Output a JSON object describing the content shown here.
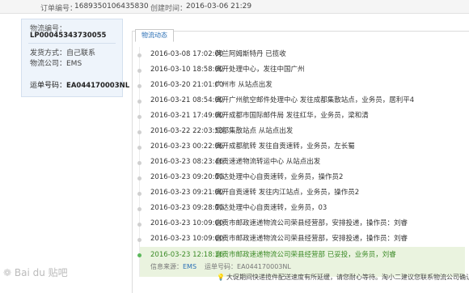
{
  "header": {
    "order_label": "订单编号：",
    "order_number": "1689350106435830",
    "created_label": "创建时间：",
    "created_time": "2016-03-06 21:29"
  },
  "sidebar": {
    "waybill_label": "物流编号：",
    "waybill_number": "LP00045343730055",
    "ship_method": "发货方式：自己联系",
    "carrier": "物流公司：EMS",
    "tracking_label": "运单号码：",
    "tracking_number": "EA044170003NL"
  },
  "tab": {
    "label": "物流动态"
  },
  "events": [
    {
      "time": "2016-03-08 17:02:00",
      "desc": "荷兰阿姆斯特丹 已揽收"
    },
    {
      "time": "2016-03-10 18:58:00",
      "desc": "离开处理中心，发往中国广州"
    },
    {
      "time": "2016-03-20 21:01:00",
      "desc": "广州市 从站点出发"
    },
    {
      "time": "2016-03-21 08:54:00",
      "desc": "离开广州航空邮件处理中心 发往成都集散站点，业务员，居利平4"
    },
    {
      "time": "2016-03-21 17:49:00",
      "desc": "离开成都市国际邮件局 发往红华，业务员，梁和清"
    },
    {
      "time": "2016-03-22 22:03:53",
      "desc": "成都集散站点 从站点出发"
    },
    {
      "time": "2016-03-23 00:22:06",
      "desc": "离开成都航转 发往自贡速转，业务员，左长蜀"
    },
    {
      "time": "2016-03-23 08:23:46",
      "desc": "自贡速递物流转运中心 从站点出发"
    },
    {
      "time": "2016-03-23 09:20:00",
      "desc": "到达处理中心自贡速转，业务员，操作员2"
    },
    {
      "time": "2016-03-23 09:21:00",
      "desc": "离开自贡速转 发往内江站点，业务员，操作员2"
    },
    {
      "time": "2016-03-23 09:28:00",
      "desc": "到达处理中心自贡速转，业务员，03"
    },
    {
      "time": "2016-03-23 10:09:00",
      "desc": "自贡市邮政速递物流公司荣县经营部，安排投递，操作员：刘睿"
    },
    {
      "time": "2016-03-23 10:09:00",
      "desc": "自贡市邮政速递物流公司荣县经营部，安排投递，操作员：刘睿"
    }
  ],
  "latest": {
    "time": "2016-03-23 12:18:36",
    "desc": "自贡市邮政速递物流公司荣县经营部 已妥投，业务员，刘睿",
    "source_label": "信息来源：",
    "source_link": "EMS",
    "tracking_text": "运单号码：EA044170003NL"
  },
  "notice": "大促期间快递揽件配送速度有所延缓，请您耐心等待。淘小二建议您联系物流公司确认",
  "watermark": "Bai du 贴吧"
}
